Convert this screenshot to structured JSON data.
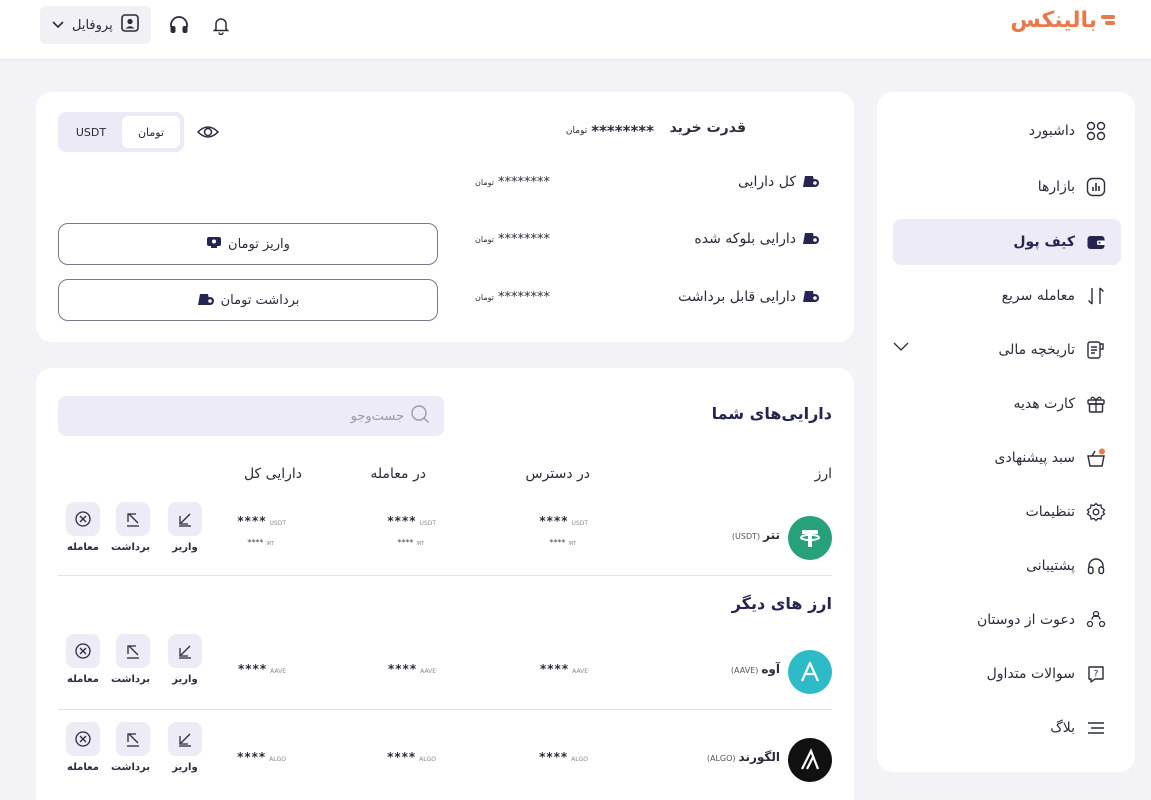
{
  "header": {
    "brand": "بالینکس",
    "profile_label": "پروفایل",
    "icons": [
      "bell-icon",
      "headset-icon",
      "user-icon",
      "chevron-down-icon"
    ]
  },
  "sidebar": {
    "items": [
      {
        "label": "داشبورد",
        "icon": "grid-icon"
      },
      {
        "label": "بازارها",
        "icon": "chart-icon"
      },
      {
        "label": "کیف پول",
        "icon": "wallet-icon",
        "active": true
      },
      {
        "label": "معامله سریع",
        "icon": "swap-icon"
      },
      {
        "label": "تاریخچه مالی",
        "icon": "receipt-icon"
      },
      {
        "label": "کارت هدیه",
        "icon": "gift-icon"
      },
      {
        "label": "سبد پیشنهادی",
        "icon": "basket-icon"
      },
      {
        "label": "تنظیمات",
        "icon": "gear-icon"
      },
      {
        "label": "پشتیبانی",
        "icon": "headset-icon"
      },
      {
        "label": "دعوت از دوستان",
        "icon": "users-icon"
      },
      {
        "label": "سوالات متداول",
        "icon": "question-icon"
      },
      {
        "label": "بلاگ",
        "icon": "menu-icon"
      }
    ]
  },
  "balance": {
    "buying_power_label": "قدرت خرید",
    "buying_power_value": "********",
    "unit": "تومان",
    "rows": [
      {
        "label": "کل دارایی",
        "value": "********"
      },
      {
        "label": "دارایی بلوکه شده",
        "value": "********"
      },
      {
        "label": "دارایی قابل برداشت",
        "value": "********"
      }
    ],
    "currency_toggle": {
      "options": [
        "USDT",
        "تومان"
      ],
      "selected": "تومان"
    },
    "deposit_button": "واریز تومان",
    "withdraw_button": "برداشت تومان"
  },
  "assets": {
    "title": "دارایی‌های شما",
    "search_placeholder": "جست‌وجو",
    "columns": [
      "ارز",
      "در دسترس",
      "در معامله",
      "دارایی کل"
    ],
    "other_title": "ارز های دیگر",
    "actions": [
      "واریز",
      "برداشت",
      "معامله"
    ],
    "masked": "****",
    "irt": "IRT",
    "own": [
      {
        "name": "تتر",
        "symbol": "(USDT)",
        "unit": "USDT",
        "color": "#26a17b"
      }
    ],
    "other": [
      {
        "name": "آوه",
        "symbol": "(AAVE)",
        "unit": "AAVE",
        "color": "#2ebac6"
      },
      {
        "name": "الگورند",
        "symbol": "(ALGO)",
        "unit": "ALGO",
        "color": "#111111"
      }
    ]
  },
  "colors": {
    "accent": "#e8794a",
    "primary": "#262552",
    "muted_bg": "#ecebf6"
  }
}
